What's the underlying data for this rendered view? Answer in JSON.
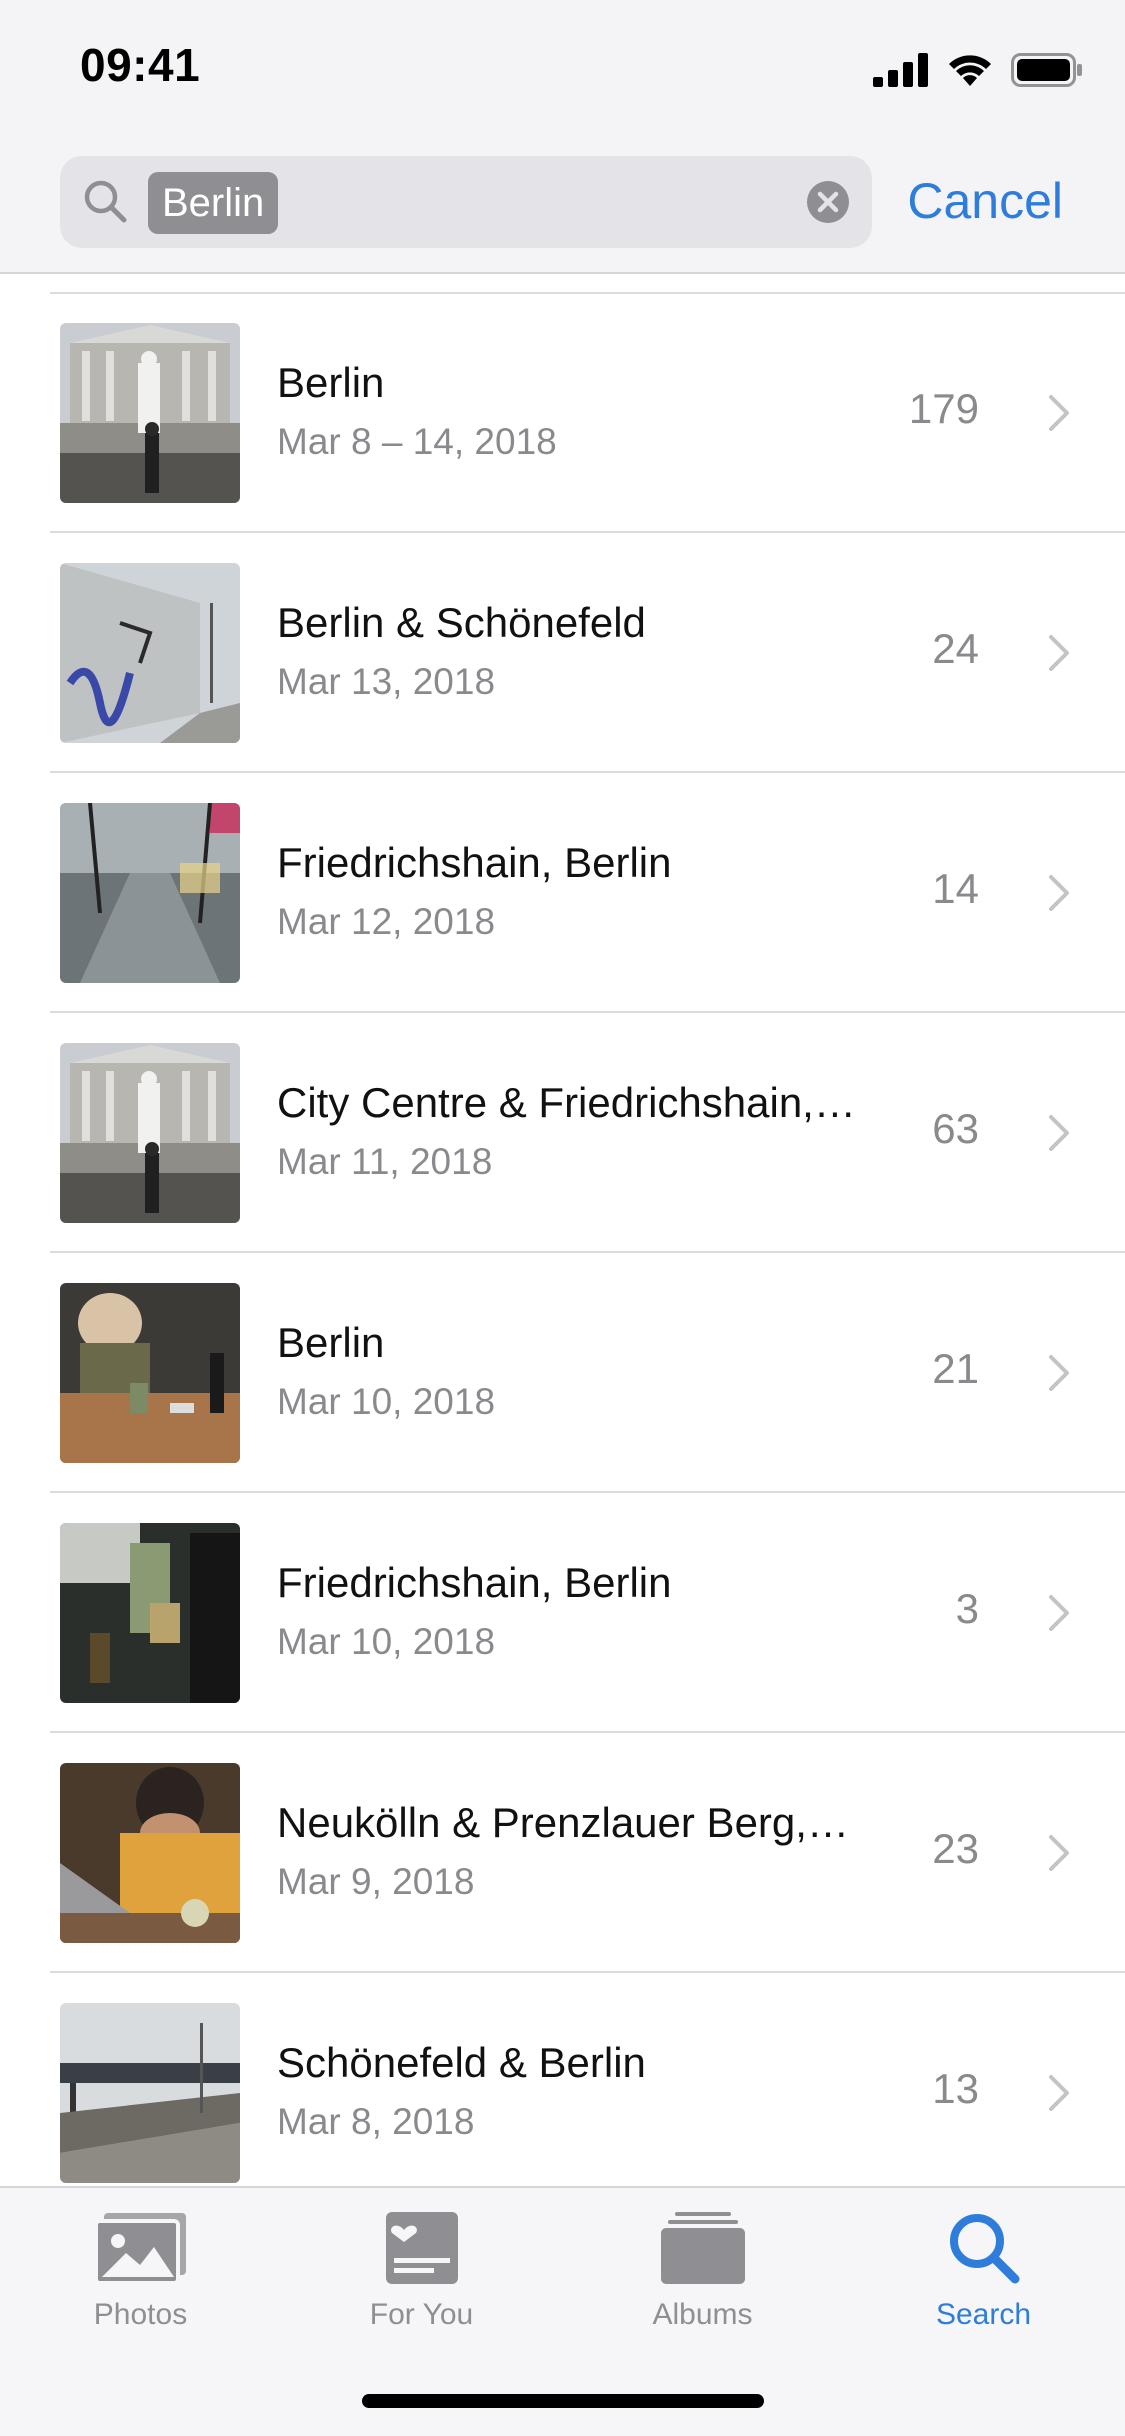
{
  "status_bar": {
    "time": "09:41"
  },
  "search": {
    "query": "Berlin",
    "cancel_label": "Cancel"
  },
  "results": [
    {
      "title": "Berlin",
      "subtitle": "Mar 8 – 14, 2018",
      "count": "179",
      "thumb": "concert-hall"
    },
    {
      "title": "Berlin & Schönefeld",
      "subtitle": "Mar 13, 2018",
      "count": "24",
      "thumb": "wall-graffiti"
    },
    {
      "title": "Friedrichshain, Berlin",
      "subtitle": "Mar 12, 2018",
      "count": "14",
      "thumb": "wet-street"
    },
    {
      "title": "City Centre & Friedrichshain,…",
      "subtitle": "Mar 11, 2018",
      "count": "63",
      "thumb": "concert-hall"
    },
    {
      "title": "Berlin",
      "subtitle": "Mar 10, 2018",
      "count": "21",
      "thumb": "bar-table"
    },
    {
      "title": "Friedrichshain, Berlin",
      "subtitle": "Mar 10, 2018",
      "count": "3",
      "thumb": "bar-tap"
    },
    {
      "title": "Neukölln & Prenzlauer Berg,…",
      "subtitle": "Mar 9, 2018",
      "count": "23",
      "thumb": "laptop-person"
    },
    {
      "title": "Schönefeld & Berlin",
      "subtitle": "Mar 8, 2018",
      "count": "13",
      "thumb": "train-platform"
    }
  ],
  "tab_bar": {
    "tabs": [
      {
        "label": "Photos",
        "icon": "photos-icon",
        "active": false
      },
      {
        "label": "For You",
        "icon": "for-you-icon",
        "active": false
      },
      {
        "label": "Albums",
        "icon": "albums-icon",
        "active": false
      },
      {
        "label": "Search",
        "icon": "search-icon",
        "active": true
      }
    ]
  },
  "colors": {
    "accent": "#2f7ddb",
    "secondary_text": "#8a8a8e",
    "separator": "#dcdcdf"
  }
}
